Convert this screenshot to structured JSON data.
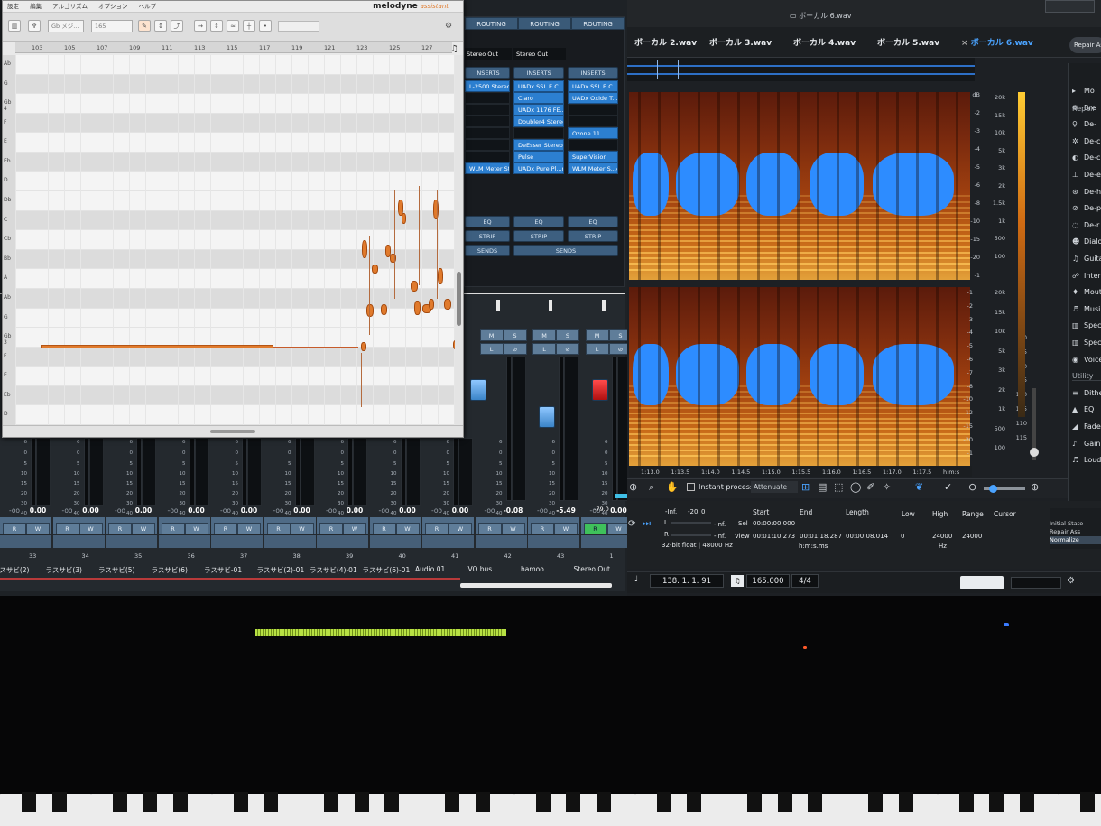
{
  "melodyne": {
    "menu": [
      "設定",
      "編集",
      "アルゴリズム",
      "オプション",
      "ヘルプ"
    ],
    "logo": "melodyne",
    "logo_sub": "assistant",
    "scale_field": "Gb メジ...",
    "tempo_field": "165",
    "ruler": [
      "103",
      "105",
      "107",
      "109",
      "111",
      "113",
      "115",
      "117",
      "119",
      "121",
      "123",
      "125",
      "127"
    ],
    "pitches": [
      "Ab",
      "G",
      "Gb 4",
      "F",
      "E",
      "Eb",
      "D",
      "Db",
      "C",
      "Cb",
      "Bb",
      "A",
      "Ab",
      "G",
      "Gb 3",
      "F",
      "E",
      "Eb",
      "D"
    ]
  },
  "routing": {
    "headers": [
      "ROUTING",
      "ROUTING",
      "ROUTING"
    ],
    "outputs": [
      "Stereo Out",
      "Stereo Out"
    ],
    "inserts_label": "INSERTS",
    "inserts_col1": [
      "L-2500 Stereo",
      "",
      "",
      "",
      "",
      "",
      "",
      "WLM Meter Stereo"
    ],
    "inserts_col2": [
      "UADx SSL E C...ip",
      "Claro",
      "UADx 1176 FE...or",
      "Doubler4 Stereo",
      "",
      "DeEsser Stereo",
      "Pulse",
      "UADx Pure Pl...rb"
    ],
    "inserts_col3": [
      "UADx SSL E C...ip",
      "UADx Oxide T...er",
      "",
      "",
      "Ozone 11",
      "",
      "SuperVision",
      "WLM Meter S...eo"
    ],
    "sections": [
      "EQ",
      "STRIP",
      "SENDS"
    ]
  },
  "mixer": {
    "scale": [
      "6",
      "0",
      "5",
      "10",
      "15",
      "20",
      "30",
      "40",
      "50",
      "60"
    ],
    "channels": [
      {
        "name": "ラスサビ(2)",
        "num": "33",
        "peak": "-oo",
        "vol": "0.00"
      },
      {
        "name": "ラスサビ(3)",
        "num": "34",
        "peak": "-oo",
        "vol": "0.00"
      },
      {
        "name": "ラスサビ(5)",
        "num": "35",
        "peak": "-oo",
        "vol": "0.00"
      },
      {
        "name": "ラスサビ(6)",
        "num": "36",
        "peak": "-oo",
        "vol": "0.00"
      },
      {
        "name": "ラスサビ-01",
        "num": "37",
        "peak": "-oo",
        "vol": "0.00"
      },
      {
        "name": "ラスサビ(2)-01",
        "num": "38",
        "peak": "-oo",
        "vol": "0.00"
      },
      {
        "name": "ラスサビ(4)-01",
        "num": "39",
        "peak": "-oo",
        "vol": "0.00"
      },
      {
        "name": "ラスサビ(6)-01",
        "num": "40",
        "peak": "-oo",
        "vol": "0.00"
      },
      {
        "name": "Audio 01",
        "num": "41",
        "peak": "-oo",
        "vol": "0.00"
      },
      {
        "name": "VO bus",
        "num": "42",
        "peak": "-oo",
        "vol": "-0.08"
      },
      {
        "name": "hamoo",
        "num": "43",
        "peak": "-oo",
        "vol": "-5.49"
      },
      {
        "name": "Stereo Out",
        "num": "1",
        "peak": "-oo",
        "vol": "0.00"
      }
    ],
    "stereo_meter": "-79.0",
    "btn_m": "M",
    "btn_s": "S",
    "btn_l": "L",
    "btn_r": "R",
    "btn_w": "W"
  },
  "rx": {
    "file_title": "ボーカル 6.wav",
    "tabs": [
      "ボーカル 2.wav",
      "ボーカル 3.wav",
      "ボーカル 4.wav",
      "ボーカル 5.wav",
      "ボーカル 6.wav"
    ],
    "repair_assistant": "Repair As",
    "db_scale": [
      "dB",
      "-2",
      "-3",
      "-4",
      "-5",
      "-6",
      "-8",
      "-10",
      "-15",
      "-20",
      "-1"
    ],
    "hz_scale": [
      "20k",
      "15k",
      "10k",
      "5k",
      "3k",
      "2k",
      "1.5k",
      "1k",
      "500",
      "100"
    ],
    "db_scale2": [
      "-1",
      "-2",
      "-3",
      "-4",
      "-5",
      "-6",
      "-7",
      "-8",
      "-10",
      "-12",
      "-15",
      "-20",
      "-1"
    ],
    "hz_scale2": [
      "20k",
      "15k",
      "10k",
      "5k",
      "3k",
      "2k",
      "1k",
      "500",
      "100"
    ],
    "meter_scale": [
      "80",
      "85",
      "90",
      "95",
      "100",
      "105",
      "110",
      "115"
    ],
    "timeline": [
      "1:13.0",
      "1:13.5",
      "1:14.0",
      "1:14.5",
      "1:15.0",
      "1:15.5",
      "1:16.0",
      "1:16.5",
      "1:17.0",
      "1:17.5",
      "h:m:s"
    ],
    "modules_header": "Repair",
    "modules": [
      "Mo",
      "Bre",
      "De-",
      "De-c",
      "De-c",
      "De-e",
      "De-h",
      "De-p",
      "De-r",
      "Dialo",
      "Guita",
      "Inter",
      "Mout",
      "Musi",
      "Spec",
      "Spec",
      "Voice",
      "Utility",
      "Dithe",
      "EQ",
      "Fade",
      "Gain",
      "Loud"
    ],
    "instant_process": "Instant process",
    "attenuate": "Attenuate",
    "info": {
      "headers": [
        "Start",
        "End",
        "Length",
        "Low",
        "High",
        "Range",
        "Cursor"
      ],
      "sel_label": "Sel",
      "view_label": "View",
      "sel_start": "00:00:00.000",
      "view_start": "00:01:10.273",
      "view_end": "00:01:18.287",
      "view_length": "00:00:08.014",
      "low": "0",
      "high": "24000",
      "range": "24000",
      "time_unit": "h:m:s.ms",
      "hz_unit": "Hz",
      "format": "32-bit float | 48000 Hz",
      "levels": [
        "-Inf.",
        "-20",
        "0",
        "-Inf.",
        "-Inf."
      ],
      "lr": [
        "L",
        "R"
      ]
    },
    "history": [
      "Initial State",
      "Repair Ass",
      "Normalize"
    ],
    "transport": {
      "position": "138. 1. 1. 91",
      "tempo": "165.000",
      "signature": "4/4"
    }
  }
}
